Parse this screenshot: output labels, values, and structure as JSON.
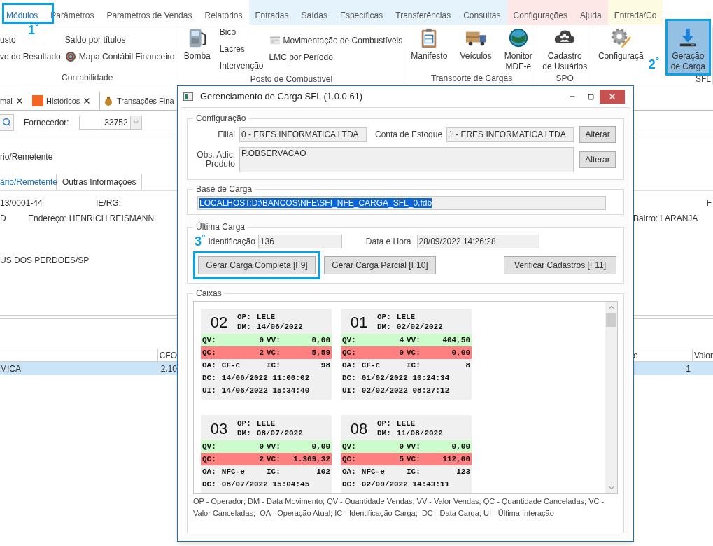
{
  "ribbon": {
    "tabs": [
      {
        "label": "Módulos",
        "selected": true,
        "color": "#ffffff"
      },
      {
        "label": "Parâmetros",
        "selected": false,
        "color": "#ffffff"
      },
      {
        "label": "Parametros de Vendas",
        "selected": false,
        "color": "#ffffff"
      },
      {
        "label": "Relatórios",
        "selected": false,
        "color": "#ffffff"
      },
      {
        "label": "Entradas",
        "selected": false,
        "color": "#e5f3fd"
      },
      {
        "label": "Saídas",
        "selected": false,
        "color": "#e5f3fd"
      },
      {
        "label": "Específicas",
        "selected": false,
        "color": "#e5f3fd"
      },
      {
        "label": "Transferências",
        "selected": false,
        "color": "#e5f3fd"
      },
      {
        "label": "Consultas",
        "selected": false,
        "color": "#e5f3fd"
      },
      {
        "label": "Configurações",
        "selected": false,
        "color": "#fde7e7"
      },
      {
        "label": "Ajuda",
        "selected": false,
        "color": "#fde7e7"
      },
      {
        "label": "Entrada/Co",
        "selected": false,
        "color": "#fdfbe1"
      }
    ],
    "groups": [
      {
        "label": "Contabilidade",
        "columns": [
          [
            {
              "label": "usto",
              "kind": "text",
              "selected": false
            },
            {
              "label": "vo do Resultado",
              "kind": "text",
              "selected": false
            }
          ],
          [
            {
              "label": "Saldo por títulos",
              "kind": "text",
              "selected": false
            },
            {
              "label": "Mapa Contábil Financeiro",
              "kind": "small",
              "selected": false
            }
          ]
        ]
      },
      {
        "label": "Posto de Combustível",
        "columns": [
          [
            {
              "label": "Bomba",
              "kind": "large",
              "selected": false
            }
          ],
          [
            {
              "label": "Bico",
              "kind": "text",
              "selected": false
            },
            {
              "label": "Lacres",
              "kind": "text",
              "selected": false
            },
            {
              "label": "Intervenção",
              "kind": "text",
              "selected": false
            }
          ],
          [
            {
              "label": "Movimentação de Combustíveis",
              "kind": "small",
              "selected": false
            },
            {
              "label": "LMC por Período",
              "kind": "text",
              "selected": false
            }
          ]
        ]
      },
      {
        "label": "Transporte de Cargas",
        "columns": [
          [
            {
              "label": "Manifesto",
              "kind": "large",
              "selected": false
            }
          ],
          [
            {
              "label": "Veículos",
              "kind": "large",
              "selected": false
            }
          ],
          [
            {
              "label": "Monitor\nMDF-e",
              "kind": "large",
              "selected": false
            }
          ]
        ]
      },
      {
        "label": "SPO",
        "columns": [
          [
            {
              "label": "Cadastro\nde Usuários",
              "kind": "large",
              "selected": false
            }
          ]
        ]
      },
      {
        "label": "SFL",
        "columns": [
          [
            {
              "label": "Configuraçã",
              "kind": "large",
              "selected": false
            }
          ],
          [
            {
              "label": "Geração\nde Carga",
              "kind": "large",
              "selected": true
            }
          ]
        ]
      }
    ]
  },
  "doc_tabs": [
    {
      "label": "mal",
      "closable": true
    },
    {
      "label": "Históricos",
      "closable": true
    },
    {
      "label": "Transações Fina",
      "closable": false
    }
  ],
  "filter": {
    "label": "Fornecedor:",
    "value": "33752"
  },
  "section_title": "rio/Remetente",
  "sub_tabs": [
    {
      "label": "ário/Remetente",
      "selected": true
    },
    {
      "label": "Outras Informações",
      "selected": false
    }
  ],
  "info": {
    "cnpj": "13/0001-44",
    "ie_label": "IE/RG:",
    "right_label": "F",
    "line2_start": "D",
    "address_label": "Endereço:",
    "address": "HENRICH REISMANN",
    "district_label": "Bairro:",
    "district": "LARANJA",
    "city": "US DOS PERDOES/SP"
  },
  "table": {
    "columns": [
      "",
      "CFO",
      "e",
      "Valor"
    ],
    "rows": [
      {
        "selected": true,
        "cells": [
          "MICA",
          "2.10",
          "1",
          ""
        ]
      }
    ]
  },
  "dialog": {
    "title": "Gerenciamento de Carga SFL (1.0.0.61)",
    "config": {
      "title": "Configuração",
      "branch_label": "Filial",
      "branch": "0 - ERES INFORMATICA LTDA",
      "stock_label": "Conta de Estoque",
      "stock": "1 - ERES INFORMATICA LTDA",
      "notes_label": "Obs. Adic.\nProduto",
      "notes": "P.OBSERVACAO",
      "change_buttons": [
        "Alterar",
        "Alterar"
      ]
    },
    "base": {
      "title": "Base de Carga",
      "path": "LOCALHOST:D:\\BANCOS\\NFE\\SFI_NFE_CARGA_SFL_0.fdb",
      "text_selected": true
    },
    "last": {
      "title": "Última Carga",
      "id_label": "Identificação",
      "id": "136",
      "date_label": "Data e Hora",
      "date": "28/09/2022 14:26:28",
      "buttons": [
        "Gerar Carga Completa [F9]",
        "Gerar Carga Parcial [F10]",
        "Verificar Cadastros [F11]"
      ]
    },
    "boxes": {
      "title": "Caixas",
      "cards": [
        {
          "number": "02",
          "head": [
            [
              "OP:",
              "LELE"
            ],
            [
              "DM:",
              "14/06/2022"
            ]
          ],
          "rows": [
            {
              "kind": "sales",
              "cells": [
                [
                  "QV:",
                  "0"
                ],
                [
                  "VV:",
                  "0,00"
                ]
              ]
            },
            {
              "kind": "canceled",
              "cells": [
                [
                  "QC:",
                  "2"
                ],
                [
                  "VC:",
                  "5,59"
                ]
              ]
            },
            {
              "kind": "plain",
              "cells": [
                [
                  "OA:",
                  "CF-e"
                ],
                [
                  "IC:",
                  "98"
                ]
              ]
            },
            {
              "kind": "plain",
              "cells": [
                [
                  "DC:",
                  "14/06/2022 11:00:02"
                ]
              ]
            },
            {
              "kind": "plain",
              "cells": [
                [
                  "UI:",
                  "14/06/2022 15:34:40"
                ]
              ]
            }
          ]
        },
        {
          "number": "01",
          "head": [
            [
              "OP:",
              "LELE"
            ],
            [
              "DM:",
              "02/02/2022"
            ]
          ],
          "rows": [
            {
              "kind": "sales",
              "cells": [
                [
                  "QV:",
                  "4"
                ],
                [
                  "VV:",
                  "404,50"
                ]
              ]
            },
            {
              "kind": "canceled",
              "cells": [
                [
                  "QC:",
                  "0"
                ],
                [
                  "VC:",
                  "0,00"
                ]
              ]
            },
            {
              "kind": "plain",
              "cells": [
                [
                  "OA:",
                  "CF-e"
                ],
                [
                  "IC:",
                  "8"
                ]
              ]
            },
            {
              "kind": "plain",
              "cells": [
                [
                  "DC:",
                  "01/02/2022 10:24:34"
                ]
              ]
            },
            {
              "kind": "plain",
              "cells": [
                [
                  "UI:",
                  "02/02/2022 08:27:12"
                ]
              ]
            }
          ]
        },
        {
          "number": "03",
          "head": [
            [
              "OP:",
              "LELE"
            ],
            [
              "DM:",
              "08/07/2022"
            ]
          ],
          "rows": [
            {
              "kind": "sales",
              "cells": [
                [
                  "QV:",
                  "0"
                ],
                [
                  "VV:",
                  "0,00"
                ]
              ]
            },
            {
              "kind": "canceled",
              "cells": [
                [
                  "QC:",
                  "2"
                ],
                [
                  "VC:",
                  "1.369,32"
                ]
              ]
            },
            {
              "kind": "plain",
              "cells": [
                [
                  "OA:",
                  "NFC-e"
                ],
                [
                  "IC:",
                  "102"
                ]
              ]
            },
            {
              "kind": "plain",
              "cells": [
                [
                  "DC:",
                  "08/07/2022 15:04:45"
                ]
              ]
            }
          ]
        },
        {
          "number": "08",
          "head": [
            [
              "OP:",
              "LELE"
            ],
            [
              "DM:",
              "11/08/2022"
            ]
          ],
          "rows": [
            {
              "kind": "sales",
              "cells": [
                [
                  "QV:",
                  "0"
                ],
                [
                  "VV:",
                  "0,00"
                ]
              ]
            },
            {
              "kind": "canceled",
              "cells": [
                [
                  "QC:",
                  "5"
                ],
                [
                  "VC:",
                  "112,00"
                ]
              ]
            },
            {
              "kind": "plain",
              "cells": [
                [
                  "OA:",
                  "NFC-e"
                ],
                [
                  "IC:",
                  "123"
                ]
              ]
            },
            {
              "kind": "plain",
              "cells": [
                [
                  "DC:",
                  "02/09/2022 14:43:11"
                ]
              ]
            }
          ]
        }
      ],
      "legend": "OP - Operador; DM - Data Movimento; QV - Quantidade Vendas; VV - Valor Vendas; QC - Quantidade Canceladas; VC - Valor Canceladas;  OA - Operação Atual; IC - Identificação Carga;  DC - Data Carga; UI - Última Interação"
    }
  },
  "annotations": [
    "1$^{°}$",
    "2$^{°}$",
    "3$^{°}$"
  ]
}
